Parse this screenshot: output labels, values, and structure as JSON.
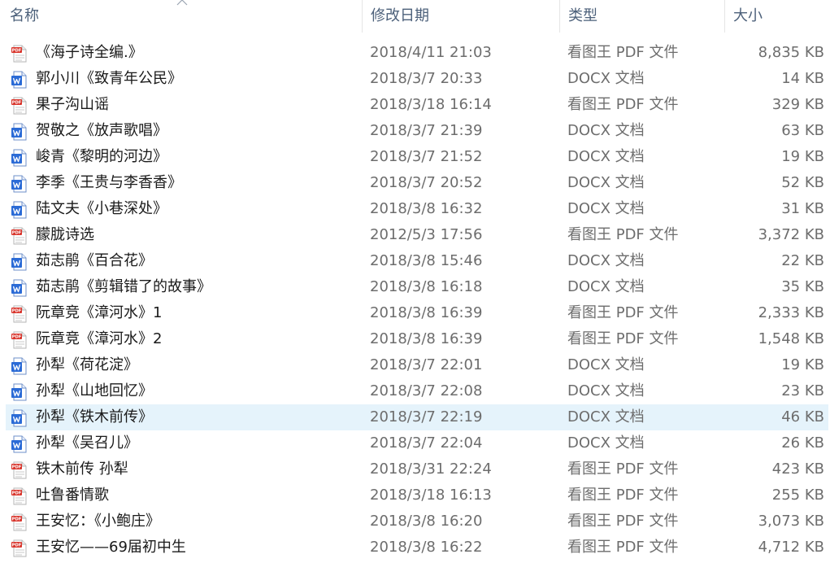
{
  "columns": {
    "name": "名称",
    "date": "修改日期",
    "type": "类型",
    "size": "大小"
  },
  "colors": {
    "header_text": "#4c607a",
    "selected_bg": "#e5f3fb",
    "pdf_red": "#d9342b",
    "word_blue": "#2b6bd6"
  },
  "files": [
    {
      "name": "《海子诗全编.》",
      "date": "2018/4/11 21:03",
      "type": "看图王 PDF 文件",
      "size": "8,835 KB",
      "icon": "pdf-file-icon",
      "selected": false
    },
    {
      "name": "郭小川《致青年公民》",
      "date": "2018/3/7 20:33",
      "type": "DOCX 文档",
      "size": "14 KB",
      "icon": "word-file-icon",
      "selected": false
    },
    {
      "name": "果子沟山谣",
      "date": "2018/3/18 16:14",
      "type": "看图王 PDF 文件",
      "size": "329 KB",
      "icon": "pdf-file-icon",
      "selected": false
    },
    {
      "name": "贺敬之《放声歌唱》",
      "date": "2018/3/7 21:39",
      "type": "DOCX 文档",
      "size": "63 KB",
      "icon": "word-file-icon",
      "selected": false
    },
    {
      "name": "峻青《黎明的河边》",
      "date": "2018/3/7 21:52",
      "type": "DOCX 文档",
      "size": "19 KB",
      "icon": "word-file-icon",
      "selected": false
    },
    {
      "name": "李季《王贵与李香香》",
      "date": "2018/3/7 20:52",
      "type": "DOCX 文档",
      "size": "52 KB",
      "icon": "word-file-icon",
      "selected": false
    },
    {
      "name": "陆文夫《小巷深处》",
      "date": "2018/3/8 16:32",
      "type": "DOCX 文档",
      "size": "31 KB",
      "icon": "word-file-icon",
      "selected": false
    },
    {
      "name": "朦胧诗选",
      "date": "2012/5/3 17:56",
      "type": "看图王 PDF 文件",
      "size": "3,372 KB",
      "icon": "pdf-file-icon",
      "selected": false
    },
    {
      "name": "茹志鹃《百合花》",
      "date": "2018/3/8 15:46",
      "type": "DOCX 文档",
      "size": "22 KB",
      "icon": "word-file-icon",
      "selected": false
    },
    {
      "name": "茹志鹃《剪辑错了的故事》",
      "date": "2018/3/8 16:18",
      "type": "DOCX 文档",
      "size": "35 KB",
      "icon": "word-file-icon",
      "selected": false
    },
    {
      "name": "阮章竞《漳河水》1",
      "date": "2018/3/8 16:39",
      "type": "看图王 PDF 文件",
      "size": "2,333 KB",
      "icon": "pdf-file-icon",
      "selected": false
    },
    {
      "name": "阮章竞《漳河水》2",
      "date": "2018/3/8 16:39",
      "type": "看图王 PDF 文件",
      "size": "1,548 KB",
      "icon": "pdf-file-icon",
      "selected": false
    },
    {
      "name": "孙犁《荷花淀》",
      "date": "2018/3/7 22:01",
      "type": "DOCX 文档",
      "size": "19 KB",
      "icon": "word-file-icon",
      "selected": false
    },
    {
      "name": "孙犁《山地回忆》",
      "date": "2018/3/7 22:08",
      "type": "DOCX 文档",
      "size": "23 KB",
      "icon": "word-file-icon",
      "selected": false
    },
    {
      "name": "孙犁《铁木前传》",
      "date": "2018/3/7 22:19",
      "type": "DOCX 文档",
      "size": "46 KB",
      "icon": "word-file-icon",
      "selected": true
    },
    {
      "name": "孙犁《吴召儿》",
      "date": "2018/3/7 22:04",
      "type": "DOCX 文档",
      "size": "26 KB",
      "icon": "word-file-icon",
      "selected": false
    },
    {
      "name": "铁木前传 孙犁",
      "date": "2018/3/31 22:24",
      "type": "看图王 PDF 文件",
      "size": "423 KB",
      "icon": "pdf-file-icon",
      "selected": false
    },
    {
      "name": "吐鲁番情歌",
      "date": "2018/3/18 16:13",
      "type": "看图王 PDF 文件",
      "size": "255 KB",
      "icon": "pdf-file-icon",
      "selected": false
    },
    {
      "name": "王安忆：《小鲍庄》",
      "date": "2018/3/8 16:20",
      "type": "看图王 PDF 文件",
      "size": "3,073 KB",
      "icon": "pdf-file-icon",
      "selected": false
    },
    {
      "name": "王安忆——69届初中生",
      "date": "2018/3/8 16:22",
      "type": "看图王 PDF 文件",
      "size": "4,712 KB",
      "icon": "pdf-file-icon",
      "selected": false
    }
  ]
}
